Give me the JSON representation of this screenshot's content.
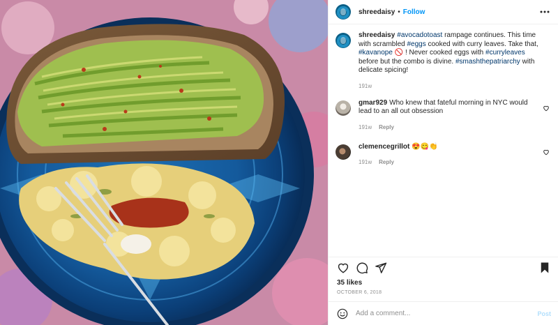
{
  "post": {
    "image_description": "",
    "author": {
      "username": "shreedaisy",
      "follow_label": "Follow",
      "separator": "•"
    },
    "caption": {
      "username": "shreedaisy",
      "parts": [
        {
          "text": "#avocadotoast",
          "tag": true
        },
        {
          "text": " rampage continues. This time with scrambled ",
          "tag": false
        },
        {
          "text": "#eggs",
          "tag": true
        },
        {
          "text": " cooked with curry leaves. Take that, ",
          "tag": false
        },
        {
          "text": "#kavanope",
          "tag": true
        },
        {
          "text": " 🚫 ! Never cooked eggs with ",
          "tag": false
        },
        {
          "text": "#curryleaves",
          "tag": true
        },
        {
          "text": " before but the combo is divine. ",
          "tag": false
        },
        {
          "text": "#smashthepatriarchy",
          "tag": true
        },
        {
          "text": " with delicate spicing!",
          "tag": false
        }
      ],
      "age": "191w"
    },
    "comments": [
      {
        "username": "gmar929",
        "text": "Who knew that fateful morning in NYC would lead to an all out obsession",
        "age": "191w",
        "reply_label": "Reply"
      },
      {
        "username": "clemencegrillot",
        "text": "😍😋👏",
        "age": "191w",
        "reply_label": "Reply"
      }
    ],
    "likes": "35 likes",
    "date": "OCTOBER 6, 2018",
    "add_comment": {
      "placeholder": "Add a comment...",
      "post_label": "Post"
    },
    "icons": {
      "more": "more-options-icon",
      "like": "heart-icon",
      "comment": "comment-icon",
      "share": "paper-plane-icon",
      "save": "bookmark-icon",
      "emoji": "smiley-icon"
    },
    "colors": {
      "link": "#0095f6",
      "hashtag": "#00376b",
      "muted": "#8e8e8e",
      "text": "#262626"
    }
  }
}
